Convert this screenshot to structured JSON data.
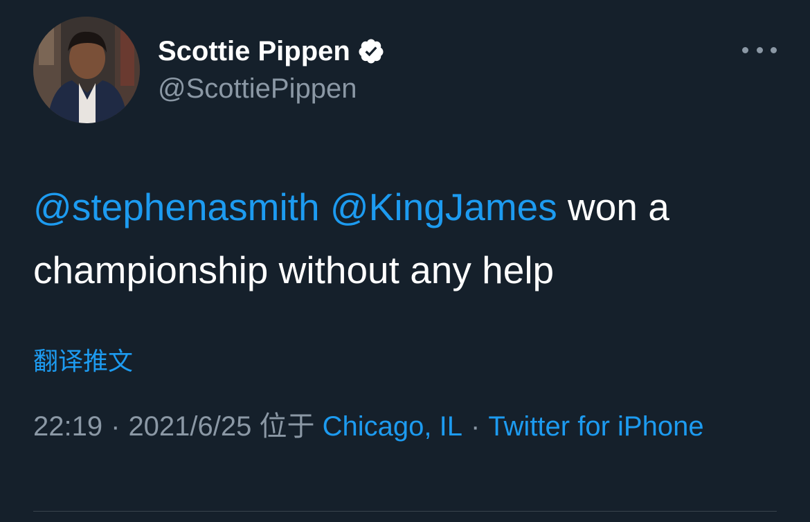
{
  "user": {
    "display_name": "Scottie Pippen",
    "handle": "@ScottiePippen",
    "verified": true,
    "avatar_icon": "profile-photo"
  },
  "tweet": {
    "mention_1": "@stephenasmith",
    "mention_2": "@KingJames",
    "text_rest": "won a championship without any help",
    "translate_label": "翻译推文"
  },
  "meta": {
    "time": "22:19",
    "separator": "·",
    "date": "2021/6/25",
    "location_prefix": "位于",
    "location": "Chicago, IL",
    "source": "Twitter for iPhone"
  },
  "colors": {
    "background": "#15202b",
    "accent": "#1d9bf0",
    "secondary_text": "#8b98a5"
  }
}
